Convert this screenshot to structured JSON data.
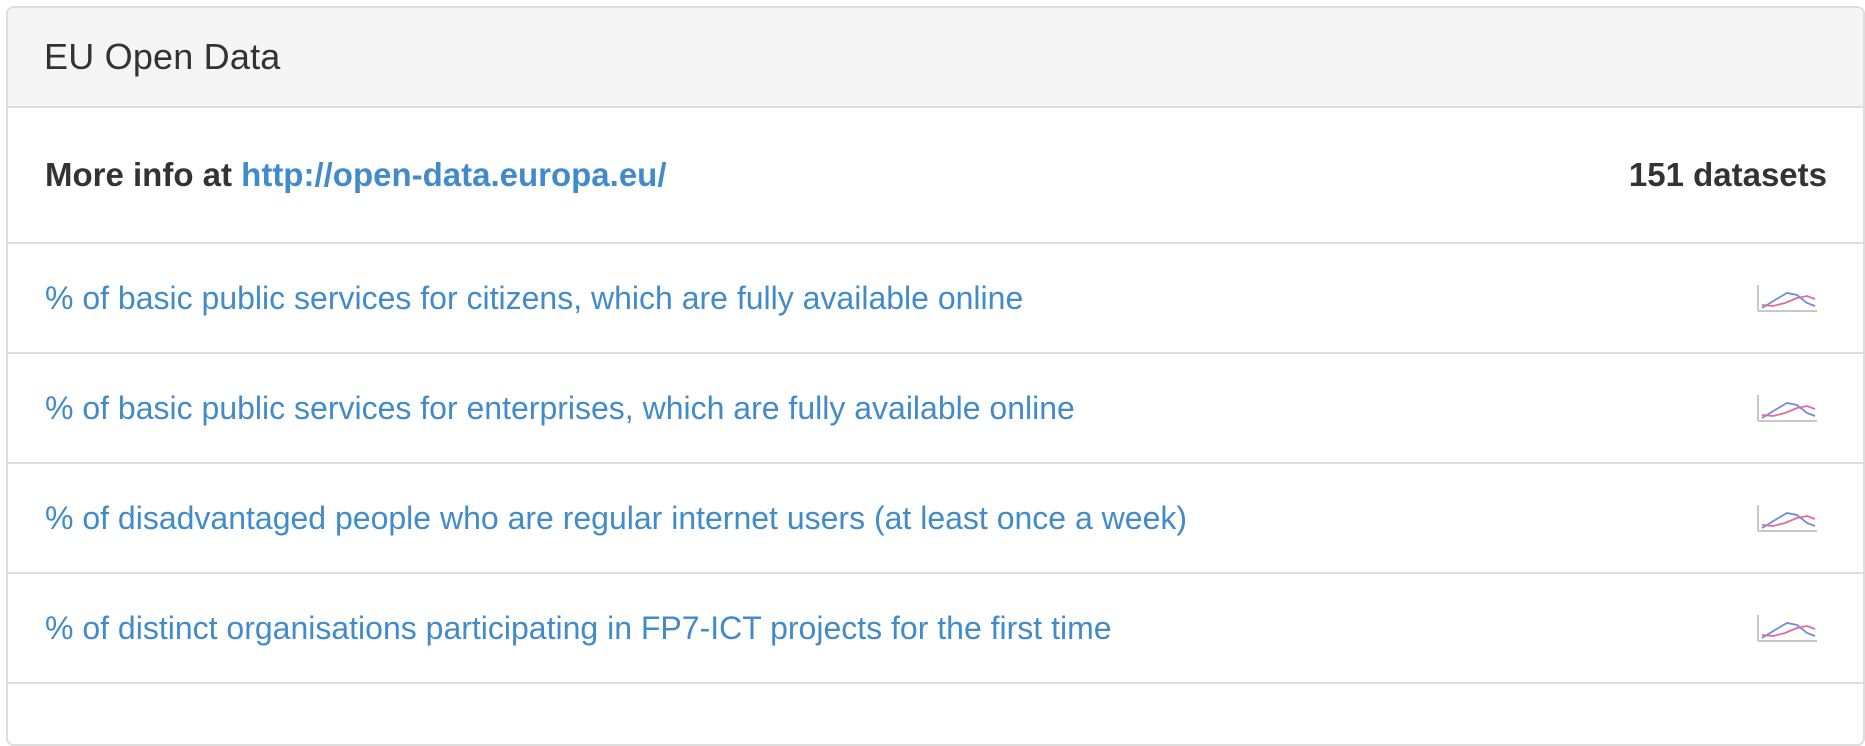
{
  "panel": {
    "title": "EU Open Data"
  },
  "info": {
    "prefix": "More info at",
    "url_text": "http://open-data.europa.eu/",
    "count_label": "151 datasets"
  },
  "datasets": [
    {
      "title": "% of basic public services for citizens, which are fully available online",
      "icon": "line-chart-icon"
    },
    {
      "title": "% of basic public services for enterprises, which are fully available online",
      "icon": "line-chart-icon"
    },
    {
      "title": "% of disadvantaged people who are regular internet users (at least once a week)",
      "icon": "line-chart-icon"
    },
    {
      "title": "% of distinct organisations participating in FP7-ICT projects for the first time",
      "icon": "line-chart-icon"
    }
  ],
  "colors": {
    "link": "#428bca",
    "heading_bg": "#f5f5f5",
    "border": "#dddddd",
    "text": "#333333"
  }
}
